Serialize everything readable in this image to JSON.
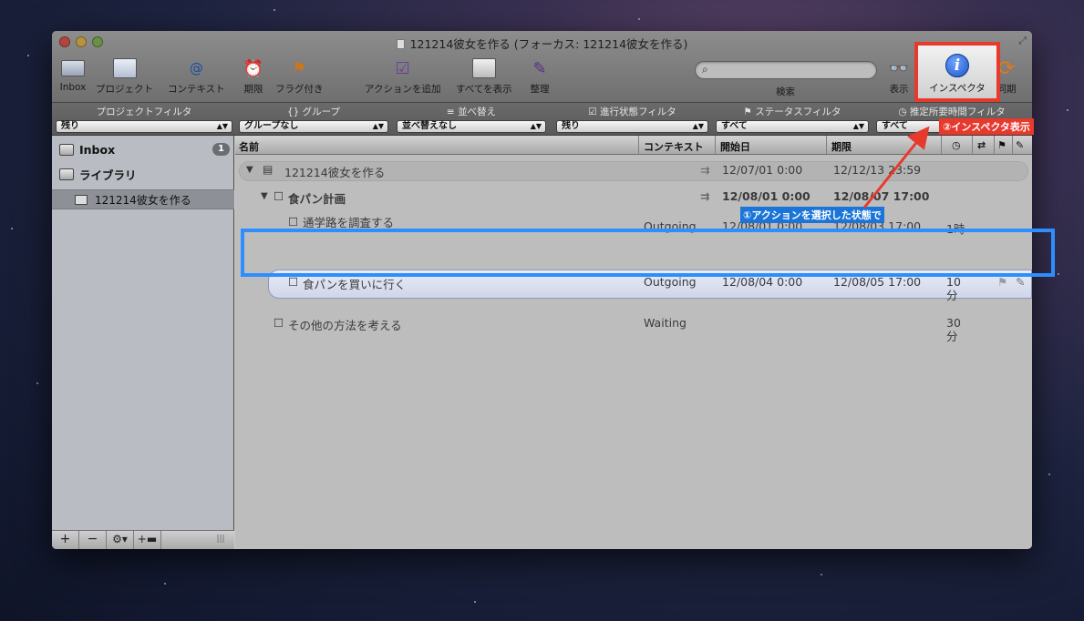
{
  "window": {
    "title": "121214彼女を作る (フォーカス: 121214彼女を作る)"
  },
  "toolbar": {
    "inbox": "Inbox",
    "project": "プロジェクト",
    "context": "コンテキスト",
    "due": "期限",
    "flagged": "フラグ付き",
    "add_action": "アクションを追加",
    "show_all": "すべてを表示",
    "cleanup": "整理",
    "search_label": "検索",
    "search_placeholder": "",
    "view": "表示",
    "inspector": "インスペクタ",
    "sync": "同期"
  },
  "filters": {
    "project_filter": {
      "label": "プロジェクトフィルタ",
      "value": "残り"
    },
    "group": {
      "label": "グループ",
      "value": "グループなし"
    },
    "sort": {
      "label": "並べ替え",
      "value": "並べ替えなし"
    },
    "status_filter": {
      "label": "進行状態フィルタ",
      "value": "残り"
    },
    "flag_filter": {
      "label": "ステータスフィルタ",
      "value": "すべて"
    },
    "duration_filter": {
      "label": "推定所要時間フィルタ",
      "value": "すべて"
    }
  },
  "sidebar": {
    "inbox": {
      "label": "Inbox",
      "count": "1"
    },
    "library": {
      "label": "ライブラリ"
    },
    "selected_project": "121214彼女を作る"
  },
  "columns": {
    "name": "名前",
    "context": "コンテキスト",
    "start": "開始日",
    "due": "期限"
  },
  "rows": [
    {
      "name": "121214彼女を作る",
      "context": "",
      "start": "12/07/01 0:00",
      "due": "12/12/13 23:59",
      "duration": ""
    },
    {
      "name": "食パン計画",
      "context": "",
      "start": "12/08/01 0:00",
      "due": "12/08/07 17:00",
      "duration": ""
    },
    {
      "name": "通学路を調査する",
      "context": "Outgoing",
      "start": "12/08/01 0:00",
      "due": "12/08/03 17:00",
      "duration": "1時"
    },
    {
      "name": "食パンを買いに行く",
      "context": "Outgoing",
      "start": "12/08/04 0:00",
      "due": "12/08/05 17:00",
      "duration": "10",
      "duration2": "分"
    },
    {
      "name": "その他の方法を考える",
      "context": "Waiting",
      "start": "",
      "due": "",
      "duration": "30",
      "duration2": "分"
    }
  ],
  "annotations": {
    "step1": "①アクションを選択した状態で",
    "step2": "②インスペクタ表示"
  },
  "colors": {
    "highlight_red": "#e8392d",
    "highlight_blue": "#2d8fff"
  }
}
